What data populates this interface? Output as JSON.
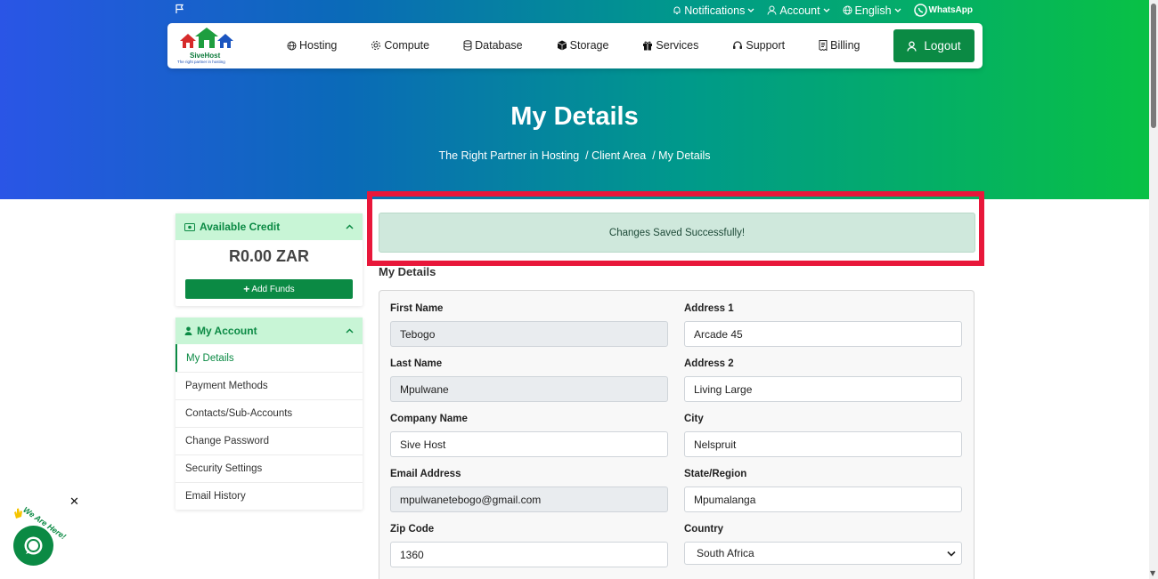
{
  "topbar": {
    "notifications": "Notifications",
    "account": "Account",
    "language": "English",
    "whatsapp": "WhatsApp"
  },
  "logo": {
    "brand": "SiveHost",
    "tagline": "The right partner in hosting"
  },
  "nav": {
    "items": [
      "Hosting",
      "Compute",
      "Database",
      "Storage",
      "Services",
      "Support",
      "Billing"
    ],
    "logout": "Logout"
  },
  "header": {
    "title": "My Details",
    "breadcrumb": [
      "The Right Partner in Hosting",
      "Client Area",
      "My Details"
    ]
  },
  "sidebar": {
    "credit": {
      "title": "Available Credit",
      "amount": "R0.00 ZAR",
      "add_funds": "Add Funds"
    },
    "account": {
      "title": "My Account",
      "items": [
        "My Details",
        "Payment Methods",
        "Contacts/Sub-Accounts",
        "Change Password",
        "Security Settings",
        "Email History"
      ]
    }
  },
  "alert": {
    "message": "Changes Saved Successfully!"
  },
  "form": {
    "title": "My Details",
    "first_name": {
      "label": "First Name",
      "value": "Tebogo"
    },
    "last_name": {
      "label": "Last Name",
      "value": "Mpulwane"
    },
    "company_name": {
      "label": "Company Name",
      "value": "Sive Host"
    },
    "email": {
      "label": "Email Address",
      "value": "mpulwanetebogo@gmail.com"
    },
    "zip": {
      "label": "Zip Code",
      "value": "1360"
    },
    "address1": {
      "label": "Address 1",
      "value": "Arcade 45"
    },
    "address2": {
      "label": "Address 2",
      "value": "Living Large"
    },
    "city": {
      "label": "City",
      "value": "Nelspruit"
    },
    "state": {
      "label": "State/Region",
      "value": "Mpumalanga"
    },
    "country": {
      "label": "Country",
      "value": "South Africa"
    }
  },
  "chat": {
    "label": "We Are Here!"
  },
  "colors": {
    "brand_green": "#0b8a44",
    "highlight_red": "#e8173a",
    "alert_bg": "#cfe8dc"
  }
}
